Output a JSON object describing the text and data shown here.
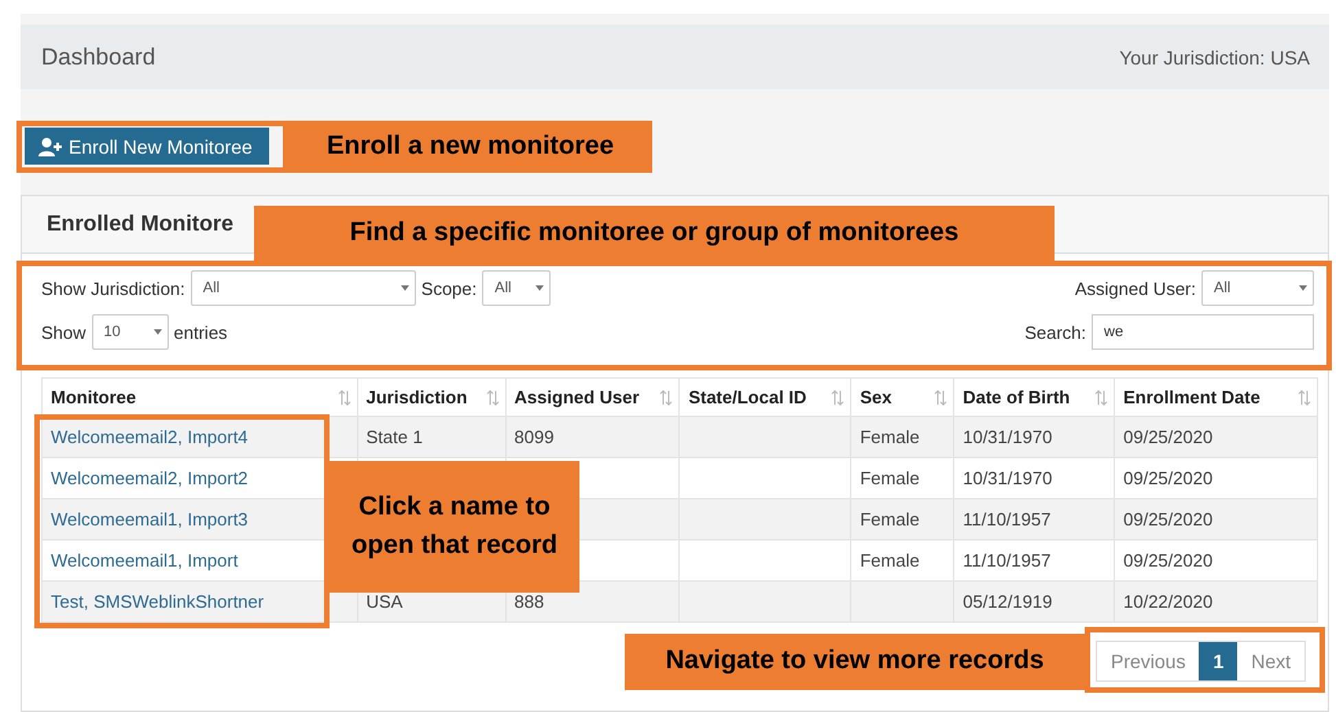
{
  "header": {
    "title": "Dashboard",
    "jurisdiction": "Your Jurisdiction: USA"
  },
  "enroll_button": "Enroll New Monitoree",
  "card_title": "Enrolled Monitore",
  "filters": {
    "jurisdiction_label": "Show Jurisdiction:",
    "jurisdiction_value": "All",
    "scope_label": "Scope:",
    "scope_value": "All",
    "assigned_user_label": "Assigned User:",
    "assigned_user_value": "All",
    "show_label": "Show",
    "show_value": "10",
    "entries_label": "entries",
    "search_label": "Search:",
    "search_value": "we"
  },
  "table": {
    "columns": [
      "Monitoree",
      "Jurisdiction",
      "Assigned User",
      "State/Local ID",
      "Sex",
      "Date of Birth",
      "Enrollment Date"
    ],
    "rows": [
      {
        "monitoree": "Welcomeemail2, Import4",
        "jurisdiction": "State 1",
        "assigned_user": "8099",
        "sex": "Female",
        "date_of_birth": "10/31/1970",
        "enrollment_date": "09/25/2020"
      },
      {
        "monitoree": "Welcomeemail2, Import2",
        "sex": "Female",
        "date_of_birth": "10/31/1970",
        "enrollment_date": "09/25/2020"
      },
      {
        "monitoree": "Welcomeemail1, Import3",
        "sex": "Female",
        "date_of_birth": "11/10/1957",
        "enrollment_date": "09/25/2020"
      },
      {
        "monitoree": "Welcomeemail1, Import",
        "sex": "Female",
        "date_of_birth": "11/10/1957",
        "enrollment_date": "09/25/2020"
      },
      {
        "monitoree": "Test, SMSWeblinkShortner",
        "jurisdiction": "USA",
        "assigned_user": "888",
        "date_of_birth": "05/12/1919",
        "enrollment_date": "10/22/2020"
      }
    ]
  },
  "pagination": {
    "previous": "Previous",
    "pages": [
      {
        "label": "1",
        "selected": true
      }
    ],
    "next": "Next"
  },
  "callouts": [
    "Enroll a new monitoree",
    "Find a specific monitoree or group of monitorees",
    "Click a name to open that record",
    "Navigate to view more records"
  ]
}
